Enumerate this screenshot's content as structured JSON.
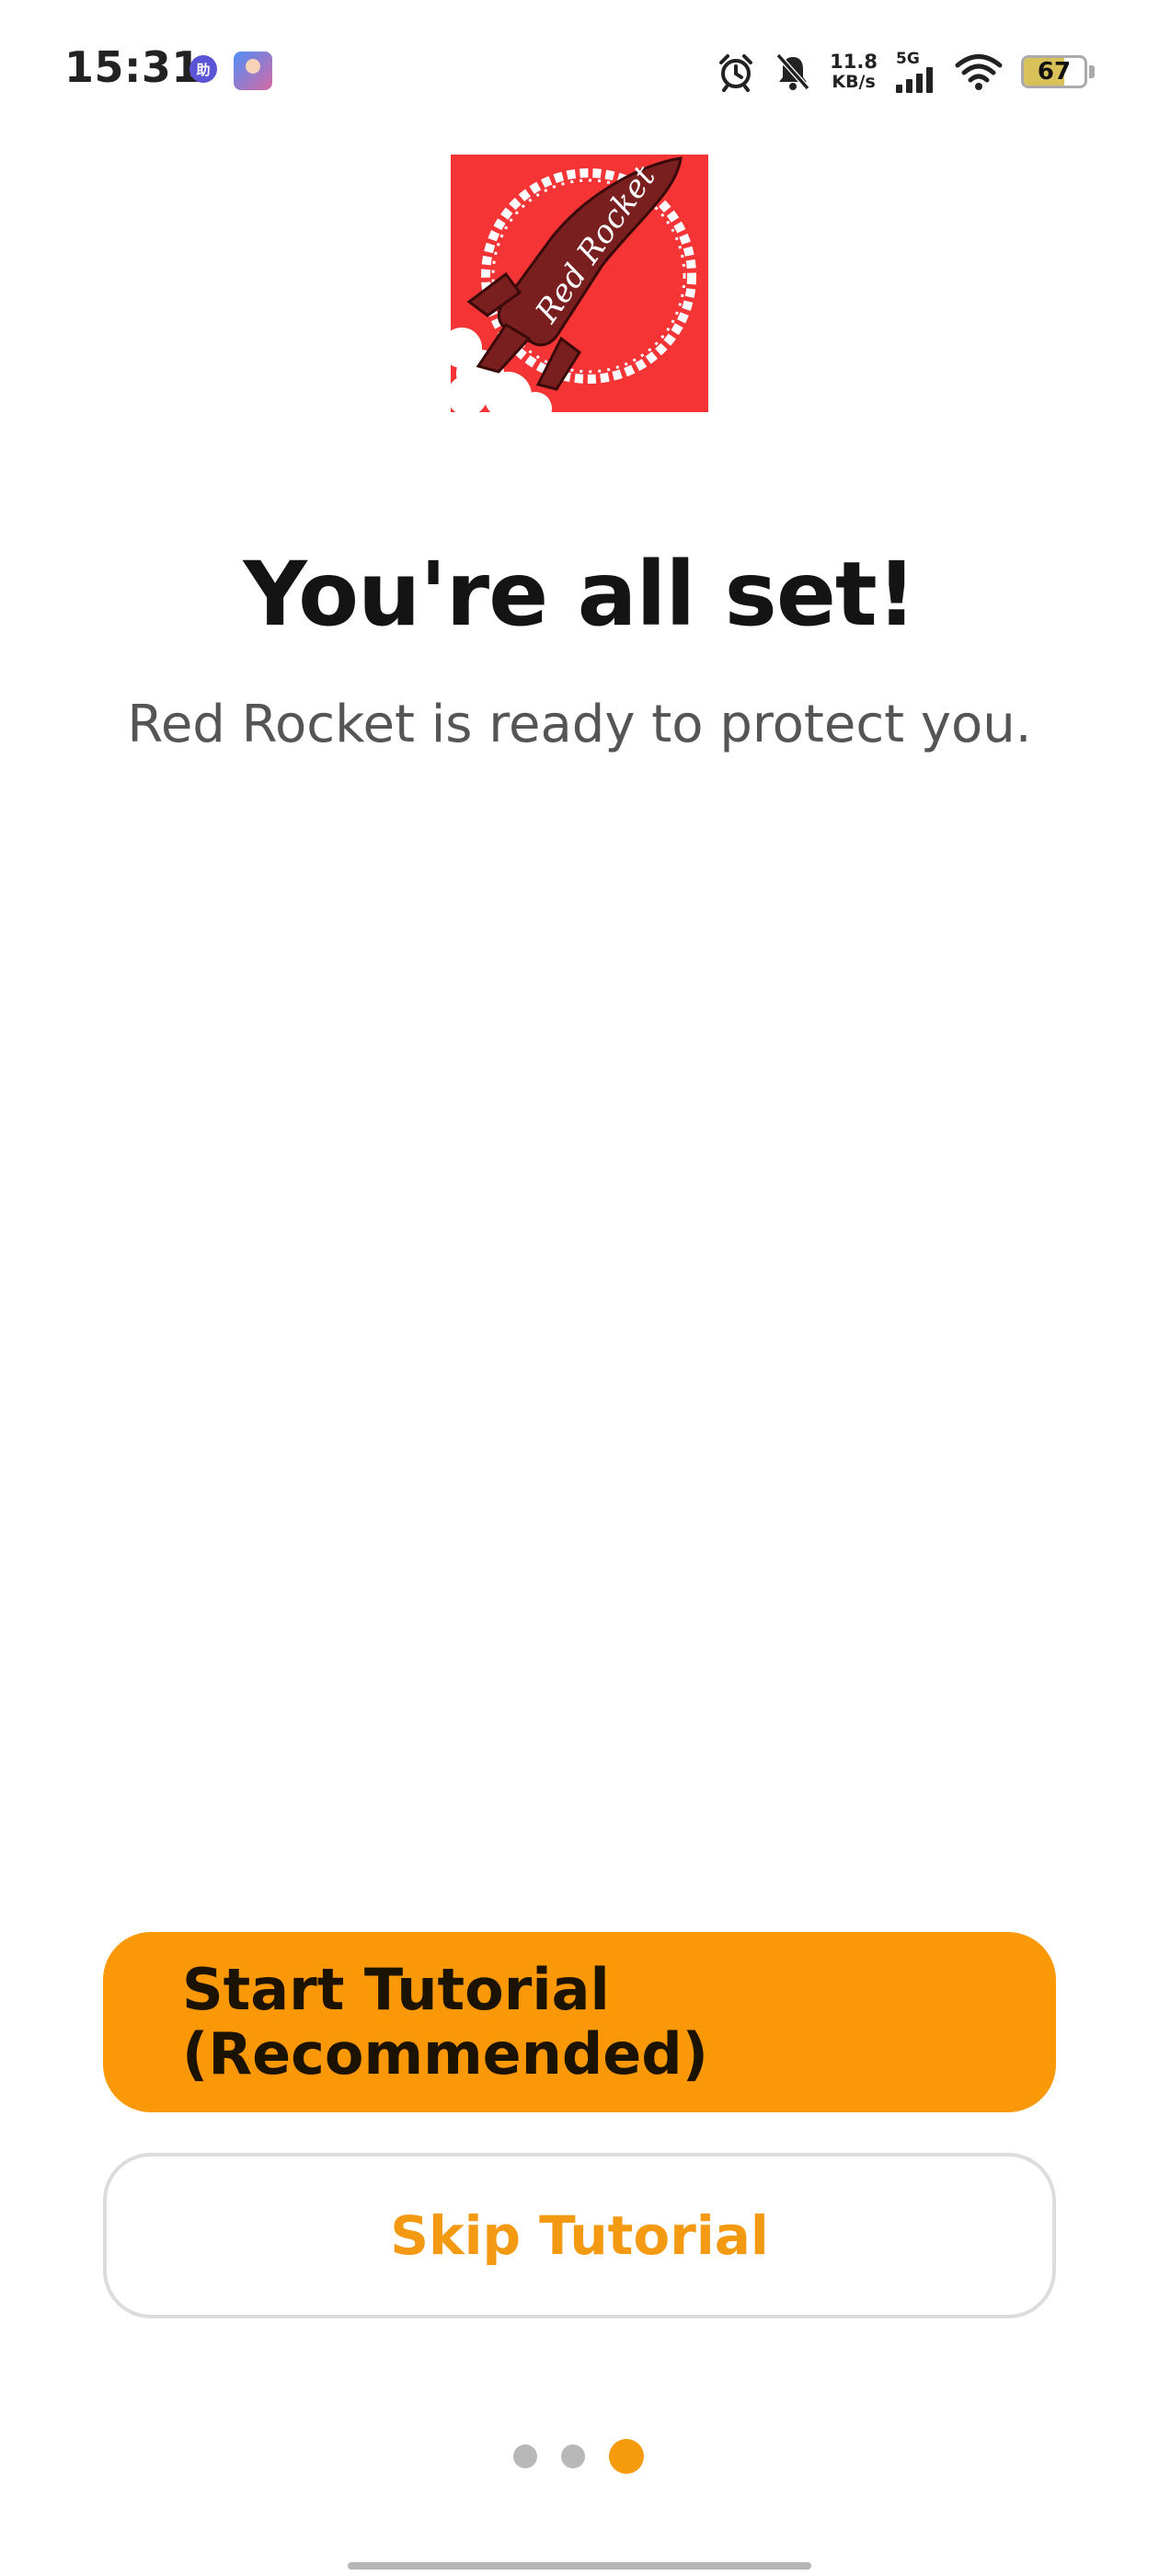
{
  "status_bar": {
    "time": "15:31",
    "notification_badge": "助",
    "net_speed_value": "11.8",
    "net_speed_unit": "KB/s",
    "network_type": "5G",
    "battery_percent": "67",
    "battery_level": 0.67,
    "icons": [
      "alarm-icon",
      "bell-muted-icon",
      "signal-icon",
      "wifi-icon",
      "battery-icon"
    ]
  },
  "logo": {
    "brand_text": "Red Rocket",
    "background_color": "#f53535",
    "rocket_color": "#7a1f1f"
  },
  "content": {
    "headline": "You're all set!",
    "subtitle": "Red Rocket is ready to protect you."
  },
  "actions": {
    "start_label": "Start Tutorial\n(Recommended)",
    "skip_label": "Skip Tutorial"
  },
  "pager": {
    "total": 3,
    "current": 3
  },
  "colors": {
    "accent": "#fa9807",
    "skip_text": "#f39a12",
    "dot_inactive": "#b8b8b8"
  }
}
